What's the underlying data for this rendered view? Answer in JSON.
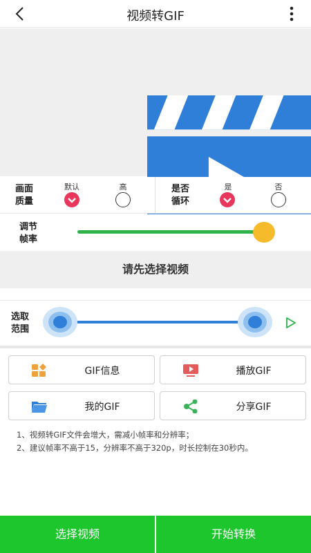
{
  "header": {
    "title": "视频转GIF"
  },
  "icons": {
    "back": "back-arrow-icon",
    "more": "more-vertical-icon",
    "video": "clapperboard-play-icon"
  },
  "quality": {
    "label_line1": "画面",
    "label_line2": "质量",
    "options": [
      {
        "label": "默认",
        "selected": true
      },
      {
        "label": "高",
        "selected": false
      }
    ]
  },
  "loop": {
    "label_line1": "是否",
    "label_line2": "循环",
    "options": [
      {
        "label": "是",
        "selected": true
      },
      {
        "label": "否",
        "selected": false
      }
    ]
  },
  "fps": {
    "label_line1": "调节",
    "label_line2": "帧率",
    "value_fraction": 0.98
  },
  "notice": "请先选择视频",
  "range": {
    "label_line1": "选取",
    "label_line2": "范围",
    "start_fraction": 0.0,
    "end_fraction": 1.0
  },
  "buttons": {
    "gif_info": "GIF信息",
    "play_gif": "播放GIF",
    "my_gif": "我的GIF",
    "share_gif": "分享GIF"
  },
  "tips": [
    "1、视频转GIF文件会增大，需减小帧率和分辨率；",
    "2、建议帧率不高于15，分辨率不高于320p，时长控制在30秒内。"
  ],
  "bottom": {
    "select_video": "选择视频",
    "start_convert": "开始转换"
  },
  "colors": {
    "accent_green": "#1ec62e",
    "radio_selected": "#e8365d",
    "slider_green": "#2db34a",
    "slider_thumb": "#f6bb2a",
    "range_blue": "#2f7fd8"
  }
}
